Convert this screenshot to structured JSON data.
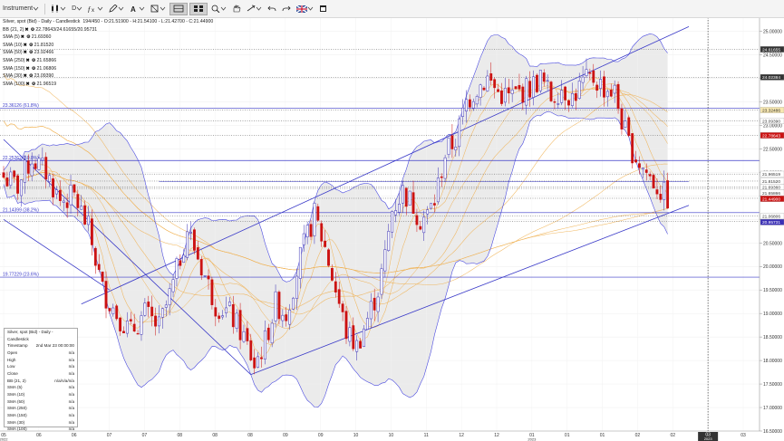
{
  "toolbar": {
    "instrument_label": "Instrument",
    "timeframe_label": "D",
    "flag_icon": "uk-flag-icon"
  },
  "header": {
    "title": "Silver, spot (Bid) - Daily - Candlestick",
    "ohlc": "194/450 - O:21.51900 - H:21.54100 - L:21.42700 - C:21.44900",
    "indicators": [
      {
        "label": "BB (21, 2)",
        "value": "22.78643/24.61655/20.95731"
      },
      {
        "label": "SMA (5)",
        "value": "21.69360"
      },
      {
        "label": "SMA (10)",
        "value": "21.81520"
      },
      {
        "label": "SMA (50)",
        "value": "23.92466"
      },
      {
        "label": "SMA (250)",
        "value": "21.65866"
      },
      {
        "label": "SMA (150)",
        "value": "21.06806"
      },
      {
        "label": "SMA (30)",
        "value": "23.09390"
      },
      {
        "label": "SMA (100)",
        "value": "21.96519"
      }
    ]
  },
  "fib_labels": [
    {
      "price": 23.36126,
      "text": "23.36126 (61.8%)"
    },
    {
      "price": 22.25262,
      "text": "22.25262 (50.0%)"
    },
    {
      "price": 21.14399,
      "text": "21.14399 (38.2%)"
    },
    {
      "price": 19.77229,
      "text": "19.77229 (23.6%)"
    }
  ],
  "price_tags": [
    {
      "price": 24.61655,
      "text": "24.61655",
      "bg": "#333333",
      "fg": "#ffffff"
    },
    {
      "price": 24.02384,
      "text": "24.02384",
      "bg": "#333333",
      "fg": "#ffffff"
    },
    {
      "price": 23.32486,
      "text": "23.32486",
      "bg": "#f7e7b0",
      "fg": "#333333"
    },
    {
      "price": 23.0939,
      "text": "23.09390",
      "bg": "#ffffff",
      "fg": "#333333"
    },
    {
      "price": 22.78643,
      "text": "22.78643",
      "bg": "#cc1111",
      "fg": "#ffffff"
    },
    {
      "price": 21.96519,
      "text": "21.96519",
      "bg": "#ffffff",
      "fg": "#333333"
    },
    {
      "price": 21.8152,
      "text": "21.81520",
      "bg": "#ffffff",
      "fg": "#333333"
    },
    {
      "price": 21.6936,
      "text": "21.69360",
      "bg": "#ffffff",
      "fg": "#333333"
    },
    {
      "price": 21.65866,
      "text": "21.65866",
      "bg": "#ffffff",
      "fg": "#333333"
    },
    {
      "price": 21.449,
      "text": "21.44900",
      "bg": "#cc1111",
      "fg": "#ffffff"
    },
    {
      "price": 21.06806,
      "text": "21.06806",
      "bg": "#ffffff",
      "fg": "#333333"
    },
    {
      "price": 20.95731,
      "text": "20.95731",
      "bg": "#3a2fb5",
      "fg": "#ffffff"
    }
  ],
  "data_window": {
    "rows": [
      {
        "label": "Silver, spot (Bid) - Daily - Candlestick",
        "value": ""
      },
      {
        "label": "Timestamp",
        "value": "2nd Mar 23 00:00:00"
      },
      {
        "label": "Open",
        "value": "n/a"
      },
      {
        "label": "High",
        "value": "n/a"
      },
      {
        "label": "Low",
        "value": "n/a"
      },
      {
        "label": "Close",
        "value": "n/a"
      },
      {
        "label": "BB (21, 2)",
        "value": "n/a/n/a/n/a"
      },
      {
        "label": "SMA (5)",
        "value": "n/a"
      },
      {
        "label": "SMA (10)",
        "value": "n/a"
      },
      {
        "label": "SMA (50)",
        "value": "n/a"
      },
      {
        "label": "SMA (250)",
        "value": "n/a"
      },
      {
        "label": "SMA (150)",
        "value": "n/a"
      },
      {
        "label": "SMA (30)",
        "value": "n/a"
      },
      {
        "label": "SMA (100)",
        "value": "n/a"
      }
    ]
  },
  "colors": {
    "bull": "#3a2fb5",
    "bear": "#cc1111",
    "trendline": "#3a3ac8",
    "fib": "#3a3ac8",
    "bb": "#4a4ae0",
    "sma": "#f0b050"
  },
  "chart_data": {
    "type": "candlestick",
    "title": "Silver, spot (Bid) - Daily - Candlestick",
    "ylim": [
      16.5,
      25.3
    ],
    "y_ticks": [
      25.0,
      24.5,
      24.0,
      23.5,
      23.0,
      22.5,
      22.0,
      21.5,
      21.0,
      20.5,
      20.0,
      19.5,
      19.0,
      18.5,
      18.0,
      17.5,
      17.0,
      16.5
    ],
    "y_tick_labels": [
      "25.00000",
      "24.50000",
      "24.00000",
      "23.50000",
      "23.00000",
      "22.50000",
      "22.00000",
      "21.50000",
      "21.00000",
      "20.50000",
      "20.00000",
      "19.50000",
      "19.00000",
      "18.50000",
      "18.00000",
      "17.50000",
      "17.00000",
      "16.50000"
    ],
    "x_labels": [
      {
        "text": "05",
        "sub": "2022"
      },
      {
        "text": "06",
        "sub": ""
      },
      {
        "text": "06",
        "sub": ""
      },
      {
        "text": "07",
        "sub": ""
      },
      {
        "text": "07",
        "sub": ""
      },
      {
        "text": "08",
        "sub": ""
      },
      {
        "text": "08",
        "sub": ""
      },
      {
        "text": "08",
        "sub": ""
      },
      {
        "text": "09",
        "sub": ""
      },
      {
        "text": "09",
        "sub": ""
      },
      {
        "text": "10",
        "sub": ""
      },
      {
        "text": "10",
        "sub": ""
      },
      {
        "text": "11",
        "sub": ""
      },
      {
        "text": "12",
        "sub": ""
      },
      {
        "text": "12",
        "sub": ""
      },
      {
        "text": "01",
        "sub": "2023"
      },
      {
        "text": "01",
        "sub": ""
      },
      {
        "text": "01",
        "sub": ""
      },
      {
        "text": "02",
        "sub": ""
      },
      {
        "text": "02",
        "sub": ""
      },
      {
        "text": "03",
        "sub": "2023"
      },
      {
        "text": "03",
        "sub": ""
      }
    ],
    "x_highlight_index": 20,
    "close_path": [
      [
        0,
        21.9
      ],
      [
        4,
        21.7
      ],
      [
        8,
        22.3
      ],
      [
        12,
        22.0
      ],
      [
        16,
        21.4
      ],
      [
        20,
        21.5
      ],
      [
        24,
        20.8
      ],
      [
        28,
        19.5
      ],
      [
        32,
        19.0
      ],
      [
        36,
        18.6
      ],
      [
        40,
        19.0
      ],
      [
        44,
        18.7
      ],
      [
        48,
        19.6
      ],
      [
        52,
        20.8
      ],
      [
        56,
        20.0
      ],
      [
        60,
        19.2
      ],
      [
        64,
        19.0
      ],
      [
        68,
        18.5
      ],
      [
        71,
        17.9
      ],
      [
        74,
        18.4
      ],
      [
        77,
        19.2
      ],
      [
        80,
        19.0
      ],
      [
        84,
        20.2
      ],
      [
        88,
        21.1
      ],
      [
        91,
        20.4
      ],
      [
        94,
        19.5
      ],
      [
        97,
        18.6
      ],
      [
        100,
        18.3
      ],
      [
        103,
        18.9
      ],
      [
        106,
        19.5
      ],
      [
        108,
        20.2
      ],
      [
        110,
        21.2
      ],
      [
        113,
        21.6
      ],
      [
        116,
        21.3
      ],
      [
        118,
        21.0
      ],
      [
        120,
        21.1
      ],
      [
        122,
        21.4
      ],
      [
        125,
        22.4
      ],
      [
        128,
        22.7
      ],
      [
        131,
        23.5
      ],
      [
        134,
        23.8
      ],
      [
        137,
        24.0
      ],
      [
        140,
        23.7
      ],
      [
        143,
        23.6
      ],
      [
        146,
        23.7
      ],
      [
        149,
        23.8
      ],
      [
        152,
        24.0
      ],
      [
        155,
        23.6
      ],
      [
        158,
        23.8
      ],
      [
        161,
        23.6
      ],
      [
        164,
        23.9
      ],
      [
        167,
        24.0
      ],
      [
        170,
        23.8
      ],
      [
        173,
        23.7
      ],
      [
        175,
        23.1
      ],
      [
        177,
        22.6
      ],
      [
        180,
        22.2
      ],
      [
        183,
        21.9
      ],
      [
        186,
        21.6
      ],
      [
        188,
        21.45
      ]
    ]
  }
}
